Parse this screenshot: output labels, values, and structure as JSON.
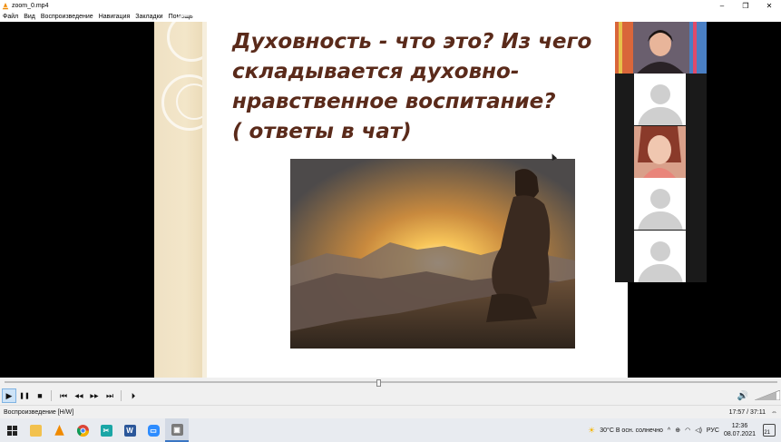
{
  "window": {
    "title": "zoom_0.mp4",
    "minimize": "–",
    "maximize": "❐",
    "close": "✕"
  },
  "menu": {
    "items": [
      "Файл",
      "Вид",
      "Воспроизведение",
      "Навигация",
      "Закладки",
      "Помощь"
    ]
  },
  "slide": {
    "title_lines": [
      "Духовность  - что это? Из чего",
      "складывается духовно-",
      "нравственное воспитание?",
      "( ответы  в чат)"
    ]
  },
  "player": {
    "progress": 0.483,
    "time": "17:57 / 37:11",
    "status_text": "Воспроизведение [H/W]",
    "volume_icon": "speaker-icon",
    "icons": {
      "play": "▶",
      "pause": "❚❚",
      "stop": "■",
      "prev": "⏮",
      "rewind": "◀◀",
      "forward": "▶▶",
      "next": "⏭",
      "frame": "⏵",
      "volume": "🔊"
    }
  },
  "taskbar": {
    "weather": "30°C  В осн. солнечно",
    "lang": "РУС",
    "clock_time": "12:36",
    "clock_date": "08.07.2021",
    "notifications": "21",
    "tray_up": "^"
  },
  "colors": {
    "slide_title": "#5a2a1a",
    "seek_fill": "#9bc4ea",
    "taskbar_bg": "#e8ebf0"
  }
}
